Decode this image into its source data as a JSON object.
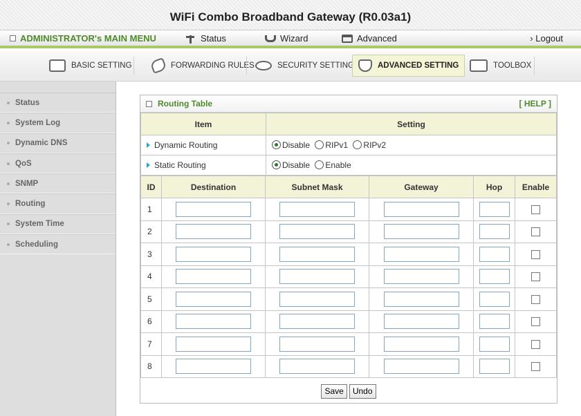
{
  "app_title": "WiFi Combo Broadband Gateway (R0.03a1)",
  "menubar": {
    "admin_label": "ADMINISTRATOR's MAIN MENU",
    "status_label": "Status",
    "wizard_label": "Wizard",
    "advanced_label": "Advanced",
    "logout_label": "› Logout"
  },
  "tabs": [
    {
      "label": "BASIC SETTING",
      "icon": "basic-setting-icon"
    },
    {
      "label": "FORWARDING RULES",
      "icon": "forwarding-rules-icon"
    },
    {
      "label": "SECURITY SETTING",
      "icon": "security-setting-icon"
    },
    {
      "label": "ADVANCED SETTING",
      "icon": "advanced-setting-icon",
      "active": true
    },
    {
      "label": "TOOLBOX",
      "icon": "toolbox-icon"
    }
  ],
  "sidebar": {
    "items": [
      "Status",
      "System Log",
      "Dynamic DNS",
      "QoS",
      "SNMP",
      "Routing",
      "System Time",
      "Scheduling"
    ]
  },
  "panel": {
    "title": "Routing Table",
    "help": "[ HELP ]",
    "col_item": "Item",
    "col_setting": "Setting",
    "dynamic_routing": {
      "label": "Dynamic Routing",
      "options": [
        "Disable",
        "RIPv1",
        "RIPv2"
      ],
      "selected": "Disable"
    },
    "static_routing": {
      "label": "Static Routing",
      "options": [
        "Disable",
        "Enable"
      ],
      "selected": "Disable"
    },
    "route_headers": [
      "ID",
      "Destination",
      "Subnet Mask",
      "Gateway",
      "Hop",
      "Enable"
    ],
    "route_ids": [
      "1",
      "2",
      "3",
      "4",
      "5",
      "6",
      "7",
      "8"
    ],
    "save_label": "Save",
    "undo_label": "Undo"
  },
  "colors": {
    "accent_green": "#4e8a2a",
    "header_cell_bg": "#f3f3d8",
    "input_border": "#7fa6c4"
  }
}
